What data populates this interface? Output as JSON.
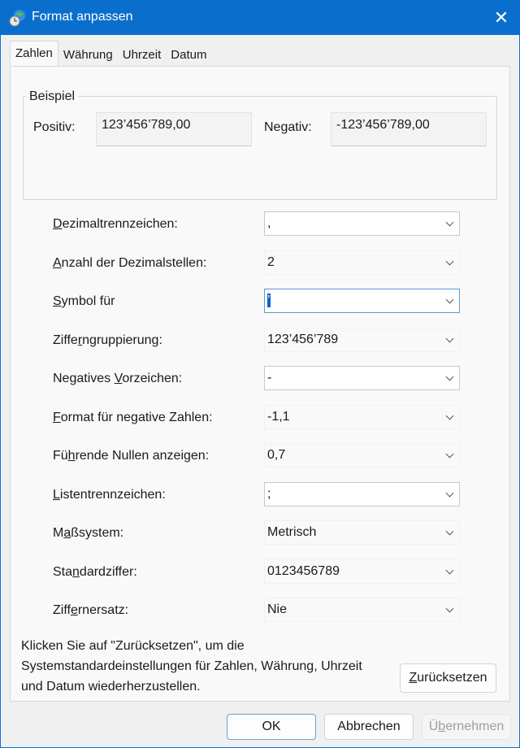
{
  "window": {
    "title": "Format anpassen"
  },
  "tabs": [
    "Zahlen",
    "Währung",
    "Uhrzeit",
    "Datum"
  ],
  "example": {
    "title": "Beispiel",
    "positive_label": "Positiv:",
    "positive_value": "123’456’789,00",
    "negative_label": "Negativ:",
    "negative_value": "-123’456’789,00"
  },
  "fields": [
    {
      "pre": "",
      "key": "D",
      "post": "ezimaltrennzeichen:",
      "value": ","
    },
    {
      "pre": "",
      "key": "A",
      "post": "nzahl der Dezimalstellen:",
      "value": "2"
    },
    {
      "pre": "",
      "key": "S",
      "post": "ymbol für",
      "value": "’"
    },
    {
      "pre": "Ziffe",
      "key": "r",
      "post": "ngruppierung:",
      "value": "123’456’789"
    },
    {
      "pre": "Negatives ",
      "key": "V",
      "post": "orzeichen:",
      "value": "-"
    },
    {
      "pre": "",
      "key": "F",
      "post": "ormat für negative Zahlen:",
      "value": "-1,1"
    },
    {
      "pre": "Fü",
      "key": "h",
      "post": "rende Nullen anzeigen:",
      "value": "0,7"
    },
    {
      "pre": "",
      "key": "L",
      "post": "istentrennzeichen:",
      "value": ";"
    },
    {
      "pre": "M",
      "key": "a",
      "post": "ßsystem:",
      "value": "Metrisch"
    },
    {
      "pre": "Sta",
      "key": "n",
      "post": "dardziffer:",
      "value": "0123456789"
    },
    {
      "pre": "Ziff",
      "key": "e",
      "post": "rnersatz:",
      "value": "Nie"
    }
  ],
  "info_text": "Klicken Sie auf \"Zurücksetzen\", um die Systemstandardeinstellungen für Zahlen, Währung, Uhrzeit und Datum wiederherzustellen.",
  "buttons": {
    "reset_key": "Z",
    "reset_rest": "urücksetzen",
    "ok": "OK",
    "cancel": "Abbrechen",
    "apply_pre": "Ü",
    "apply_key": "b",
    "apply_post": "ernehmen"
  }
}
